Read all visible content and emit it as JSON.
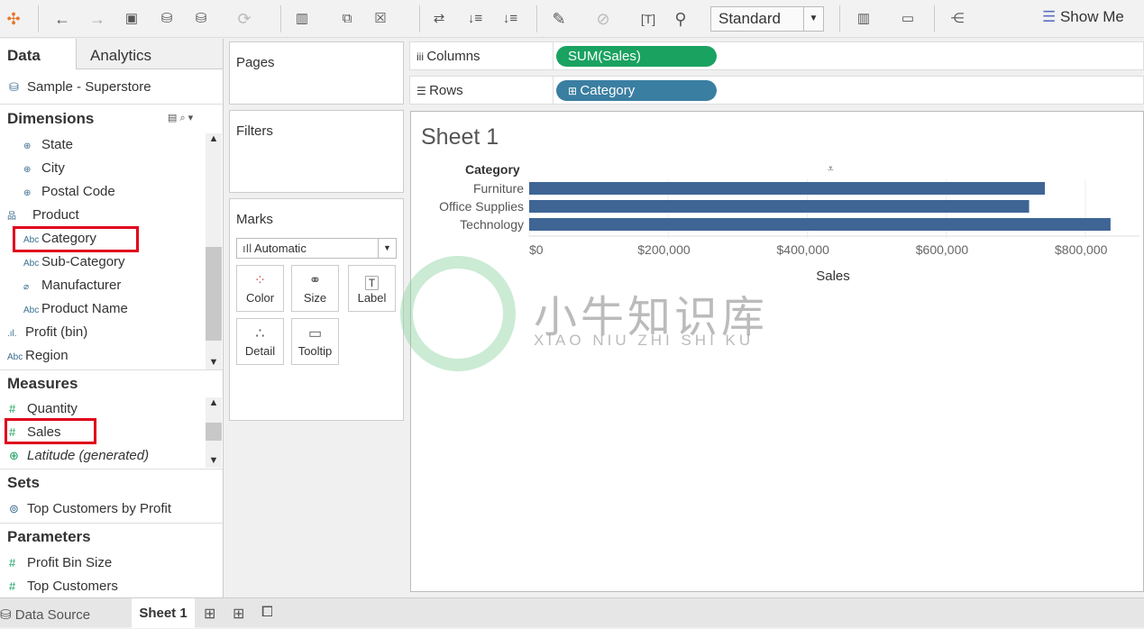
{
  "toolbar": {
    "icons": [
      "tableau-logo-icon",
      "back-icon",
      "forward-icon",
      "save-icon",
      "new-data-source-icon",
      "pause-updates-icon",
      "refresh-icon",
      "new-worksheet-icon",
      "duplicate-sheet-icon",
      "clear-sheet-icon",
      "swap-icon",
      "sort-ascending-icon",
      "sort-descending-icon",
      "highlight-icon",
      "annotate-icon",
      "text-icon",
      "pin-icon",
      "chart-size-icon",
      "presentation-icon",
      "share-icon"
    ],
    "fit": "Standard",
    "show_me": "Show Me"
  },
  "left": {
    "tab_data": "Data",
    "tab_analytics": "Analytics",
    "datasource": "Sample - Superstore",
    "dimensions_label": "Dimensions",
    "dimensions": [
      {
        "icon": "globe",
        "label": "State"
      },
      {
        "icon": "globe",
        "label": "City"
      },
      {
        "icon": "globe",
        "label": "Postal Code"
      },
      {
        "icon": "hierarchy",
        "label": "Product"
      },
      {
        "icon": "Abc",
        "label": "Category"
      },
      {
        "icon": "Abc",
        "label": "Sub-Category"
      },
      {
        "icon": "clip",
        "label": "Manufacturer"
      },
      {
        "icon": "Abc",
        "label": "Product Name"
      },
      {
        "icon": "bin",
        "label": "Profit (bin)"
      },
      {
        "icon": "Abc",
        "label": "Region"
      }
    ],
    "measures_label": "Measures",
    "measures": [
      {
        "label": "Quantity"
      },
      {
        "label": "Sales"
      },
      {
        "label": "Latitude (generated)"
      }
    ],
    "sets_label": "Sets",
    "sets": [
      {
        "label": "Top Customers by Profit"
      }
    ],
    "parameters_label": "Parameters",
    "parameters": [
      {
        "label": "Profit Bin Size"
      },
      {
        "label": "Top Customers"
      }
    ]
  },
  "cards": {
    "pages": "Pages",
    "filters": "Filters",
    "marks": "Marks",
    "mark_type": "Automatic",
    "buttons": [
      "Color",
      "Size",
      "Label",
      "Detail",
      "Tooltip"
    ]
  },
  "shelves": {
    "columns": "Columns",
    "rows": "Rows",
    "columns_pill": "SUM(Sales)",
    "rows_pill": "Category",
    "columns_color": "#1aa260",
    "rows_color": "#3a7ea1"
  },
  "sheet": {
    "title": "Sheet 1"
  },
  "chart_data": {
    "type": "bar",
    "orientation": "horizontal",
    "row_header": "Category",
    "categories": [
      "Furniture",
      "Office Supplies",
      "Technology"
    ],
    "values": [
      741718,
      719047,
      836154
    ],
    "xlabel": "Sales",
    "xlim": [
      0,
      880000
    ],
    "ticks": [
      "$0",
      "$200,000",
      "$400,000",
      "$600,000",
      "$800,000"
    ],
    "tick_values": [
      0,
      200000,
      400000,
      600000,
      800000
    ],
    "grid": true,
    "color": "#3e6594"
  },
  "watermark": {
    "cn": "小牛知识库",
    "en": "XIAO NIU ZHI SHI KU"
  },
  "bottom": {
    "datasource": "Data Source",
    "sheet": "Sheet 1"
  }
}
